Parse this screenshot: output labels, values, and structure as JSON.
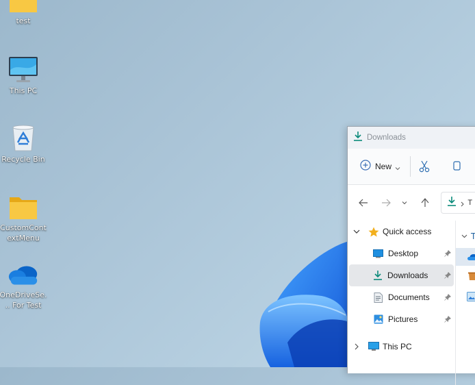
{
  "desktop": {
    "icons": [
      {
        "name": "test",
        "icon": "folder-icon"
      },
      {
        "name": "This PC",
        "icon": "monitor-icon"
      },
      {
        "name": "Recycle Bin",
        "icon": "recycle-bin-icon"
      },
      {
        "name": "CustomContextMenu",
        "icon": "folder-icon"
      },
      {
        "name": "OneDriveSe... For Test",
        "icon": "onedrive-cloud-icon"
      }
    ]
  },
  "explorer": {
    "title": "Downloads",
    "toolbar": {
      "new_label": "New"
    },
    "address": {
      "first_crumb_partial": "T"
    },
    "nav": {
      "quick_access": "Quick access",
      "items": [
        {
          "label": "Desktop",
          "icon": "desktop-icon",
          "pinned": true
        },
        {
          "label": "Downloads",
          "icon": "download-icon",
          "pinned": true,
          "selected": true
        },
        {
          "label": "Documents",
          "icon": "documents-icon",
          "pinned": true
        },
        {
          "label": "Pictures",
          "icon": "pictures-icon",
          "pinned": true
        }
      ],
      "this_pc": "This PC"
    },
    "content": {
      "group_header_partial": "T"
    },
    "colors": {
      "accent": "#0a8a7a",
      "selection": "#e5e7ea",
      "star": "#f2b01e"
    }
  }
}
